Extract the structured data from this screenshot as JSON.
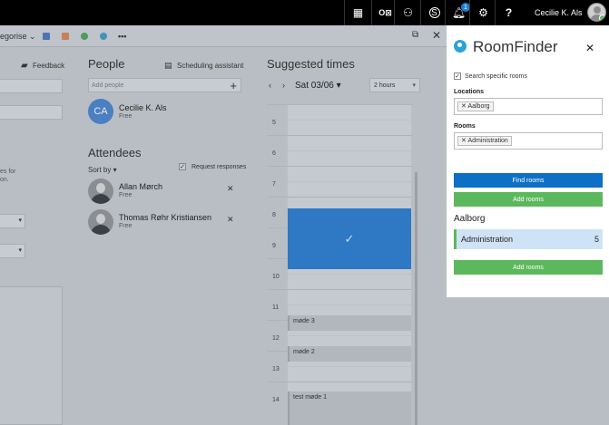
{
  "topbar": {
    "user_name": "Cecilie K. Als",
    "notification_count": "1",
    "icons": [
      "calendar-icon",
      "outlook-icon",
      "people-icon",
      "skype-icon",
      "bell-icon",
      "gear-icon",
      "help-icon"
    ]
  },
  "toolbar": {
    "categorise_label": "egorise",
    "more_label": "•••",
    "chevron": "⌄"
  },
  "form": {
    "feedback_label": "Feedback",
    "partial_text_1": "es for",
    "partial_text_2": "on."
  },
  "people": {
    "title": "People",
    "scheduling_label": "Scheduling assistant",
    "add_placeholder": "Add people",
    "organizer": {
      "initials": "CA",
      "name": "Cecilie K. Als",
      "status": "Free"
    }
  },
  "attendees": {
    "title": "Attendees",
    "sort_label": "Sort by",
    "request_label": "Request responses",
    "list": [
      {
        "name": "Allan Mørch",
        "status": "Free"
      },
      {
        "name": "Thomas Røhr Kristiansen",
        "status": "Free"
      }
    ]
  },
  "suggested": {
    "title": "Suggested times",
    "date": "Sat 03/06",
    "duration": "2 hours",
    "hours": [
      "5",
      "6",
      "7",
      "8",
      "9",
      "10",
      "11",
      "12",
      "13",
      "14"
    ],
    "events": [
      {
        "label": "møde 3"
      },
      {
        "label": "møde 2"
      },
      {
        "label": "test møde 1"
      }
    ]
  },
  "roomfinder": {
    "title": "RoomFinder",
    "search_specific_label": "Search specific rooms",
    "locations_label": "Locations",
    "location_tag": "Aalborg",
    "rooms_label": "Rooms",
    "room_tag": "Administration",
    "find_rooms_label": "Find rooms",
    "add_rooms_label": "Add rooms",
    "city": "Aalborg",
    "results": [
      {
        "name": "Administration",
        "count": "5"
      }
    ],
    "add_rooms_bottom_label": "Add rooms",
    "colors": {
      "primary": "#0e6fc7",
      "success": "#5cb85c",
      "selected_row": "#cfe3f6"
    }
  }
}
